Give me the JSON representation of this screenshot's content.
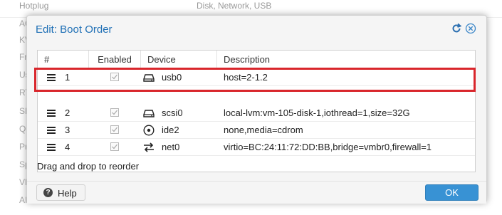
{
  "background": {
    "top_row": {
      "key": "Hotplug",
      "value": "Disk, Network, USB"
    },
    "left_labels": [
      "AC",
      "KV",
      "Fr",
      "Us",
      "RT",
      "SM",
      "QE",
      "Pr",
      "Sp",
      "VM",
      "AI"
    ]
  },
  "dialog": {
    "title": "Edit: Boot Order",
    "columns": {
      "index": "#",
      "enabled": "Enabled",
      "device": "Device",
      "description": "Description"
    },
    "rows": [
      {
        "index": "1",
        "enabled": true,
        "device_icon": "usb-drive-icon",
        "device": "usb0",
        "description": "host=2-1.2"
      },
      {
        "index": "2",
        "enabled": true,
        "device_icon": "hard-drive-icon",
        "device": "scsi0",
        "description": "local-lvm:vm-105-disk-1,iothread=1,size=32G"
      },
      {
        "index": "3",
        "enabled": true,
        "device_icon": "cdrom-icon",
        "device": "ide2",
        "description": "none,media=cdrom"
      },
      {
        "index": "4",
        "enabled": true,
        "device_icon": "network-exchange-icon",
        "device": "net0",
        "description": "virtio=BC:24:11:72:DD:BB,bridge=vmbr0,firewall=1"
      }
    ],
    "hint": "Drag and drop to reorder",
    "help_label": "Help",
    "ok_label": "OK",
    "highlight_color": "#d9262c",
    "accent_color": "#3892d4"
  }
}
